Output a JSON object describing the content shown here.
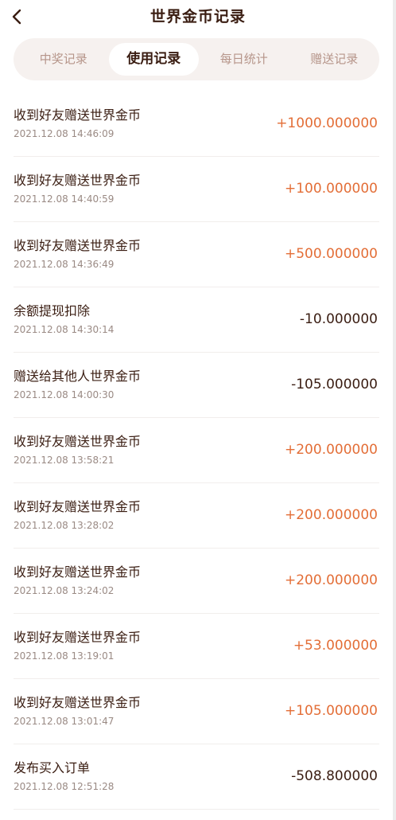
{
  "header": {
    "title": "世界金币记录",
    "back_icon": "chevron-left-icon"
  },
  "tabs": [
    {
      "label": "中奖记录",
      "active": false
    },
    {
      "label": "使用记录",
      "active": true
    },
    {
      "label": "每日统计",
      "active": false
    },
    {
      "label": "赠送记录",
      "active": false
    }
  ],
  "colors": {
    "title_text": "#3a1d12",
    "positive_amount": "#e36e37",
    "negative_amount": "#3a1d12",
    "tab_bar_bg": "#f6f1ef",
    "inactive_tab_text": "#b6958a",
    "timestamp_text": "#9a8a84"
  },
  "records": [
    {
      "title": "收到好友赠送世界金币",
      "time": "2021.12.08 14:46:09",
      "amount": "+1000.000000",
      "type": "positive"
    },
    {
      "title": "收到好友赠送世界金币",
      "time": "2021.12.08 14:40:59",
      "amount": "+100.000000",
      "type": "positive"
    },
    {
      "title": "收到好友赠送世界金币",
      "time": "2021.12.08 14:36:49",
      "amount": "+500.000000",
      "type": "positive"
    },
    {
      "title": "余额提现扣除",
      "time": "2021.12.08 14:30:14",
      "amount": "-10.000000",
      "type": "negative"
    },
    {
      "title": "赠送给其他人世界金币",
      "time": "2021.12.08 14:00:30",
      "amount": "-105.000000",
      "type": "negative"
    },
    {
      "title": "收到好友赠送世界金币",
      "time": "2021.12.08 13:58:21",
      "amount": "+200.000000",
      "type": "positive"
    },
    {
      "title": "收到好友赠送世界金币",
      "time": "2021.12.08 13:28:02",
      "amount": "+200.000000",
      "type": "positive"
    },
    {
      "title": "收到好友赠送世界金币",
      "time": "2021.12.08 13:24:02",
      "amount": "+200.000000",
      "type": "positive"
    },
    {
      "title": "收到好友赠送世界金币",
      "time": "2021.12.08 13:19:01",
      "amount": "+53.000000",
      "type": "positive"
    },
    {
      "title": "收到好友赠送世界金币",
      "time": "2021.12.08 13:01:47",
      "amount": "+105.000000",
      "type": "positive"
    },
    {
      "title": "发布买入订单",
      "time": "2021.12.08 12:51:28",
      "amount": "-508.800000",
      "type": "negative"
    }
  ]
}
